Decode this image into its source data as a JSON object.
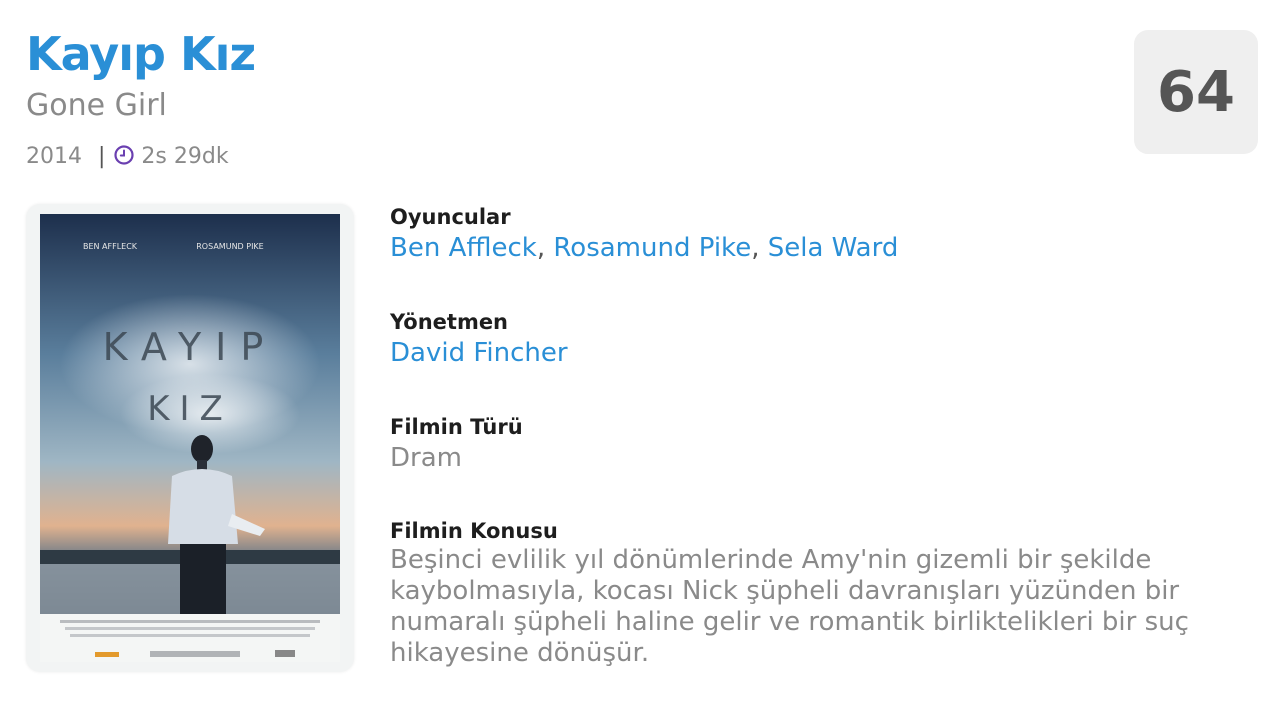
{
  "movie": {
    "title": "Kayıp Kız",
    "original_title": "Gone Girl",
    "year": "2014",
    "separator": "|",
    "duration": "2s 29dk",
    "score": "64"
  },
  "poster": {
    "actor_names": [
      "BEN AFFLECK",
      "ROSAMUND PIKE"
    ],
    "title_line1": "KAYIP",
    "title_line2": "KIZ"
  },
  "details": {
    "cast_label": "Oyuncular",
    "cast": [
      "Ben Affleck",
      "Rosamund Pike",
      "Sela Ward"
    ],
    "cast_separator": ",",
    "director_label": "Yönetmen",
    "director": "David Fincher",
    "genre_label": "Filmin Türü",
    "genre": "Dram",
    "plot_label": "Filmin Konusu",
    "plot": "Beşinci evlilik yıl dönümlerinde Amy'nin gizemli bir şekilde kaybolmasıyla, kocası Nick şüpheli davranışları yüzünden bir numaralı şüpheli haline gelir ve romantik birliktelikleri bir suç hikayesine dönüşür."
  },
  "colors": {
    "accent": "#2a8fd6",
    "muted": "#8a8a8a",
    "clock_icon": "#6a3fb0",
    "score_bg": "#efefef"
  },
  "icons": {
    "duration": "clock-icon"
  }
}
